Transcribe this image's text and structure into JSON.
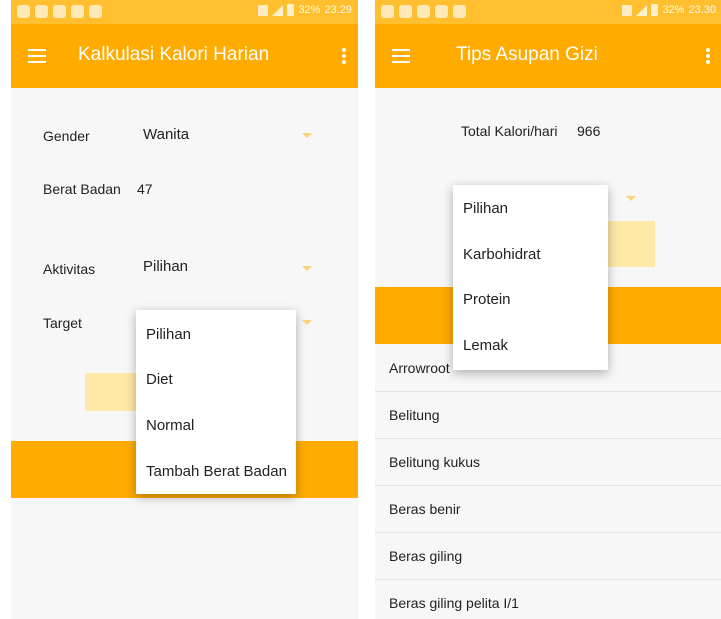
{
  "left": {
    "status": {
      "battery": "32%",
      "time": "23.29"
    },
    "toolbar_title": "Kalkulasi Kalori Harian",
    "form": {
      "gender_label": "Gender",
      "gender_value": "Wanita",
      "weight_label": "Berat Badan",
      "weight_value": "47",
      "activity_label": "Aktivitas",
      "activity_value": "Pilihan",
      "target_label": "Target"
    },
    "target_dropdown": [
      "Pilihan",
      "Diet",
      "Normal",
      "Tambah Berat Badan"
    ]
  },
  "right": {
    "status": {
      "battery": "32%",
      "time": "23.30"
    },
    "toolbar_title": "Tips Asupan Gizi",
    "total_label": "Total Kalori/hari",
    "total_value": "966",
    "category_dropdown": [
      "Pilihan",
      "Karbohidrat",
      "Protein",
      "Lemak"
    ],
    "food_list": [
      "Arrowroot",
      "Belitung",
      "Belitung kukus",
      "Beras benir",
      "Beras giling",
      "Beras giling pelita I/1"
    ]
  },
  "colors": {
    "primary": "#ffab00",
    "status_bar": "#ffbf2e",
    "button": "#ffe9a8"
  },
  "icons": {
    "menu": "hamburger-icon",
    "overflow": "more-vert-icon",
    "dropdown": "caret-down-icon"
  }
}
